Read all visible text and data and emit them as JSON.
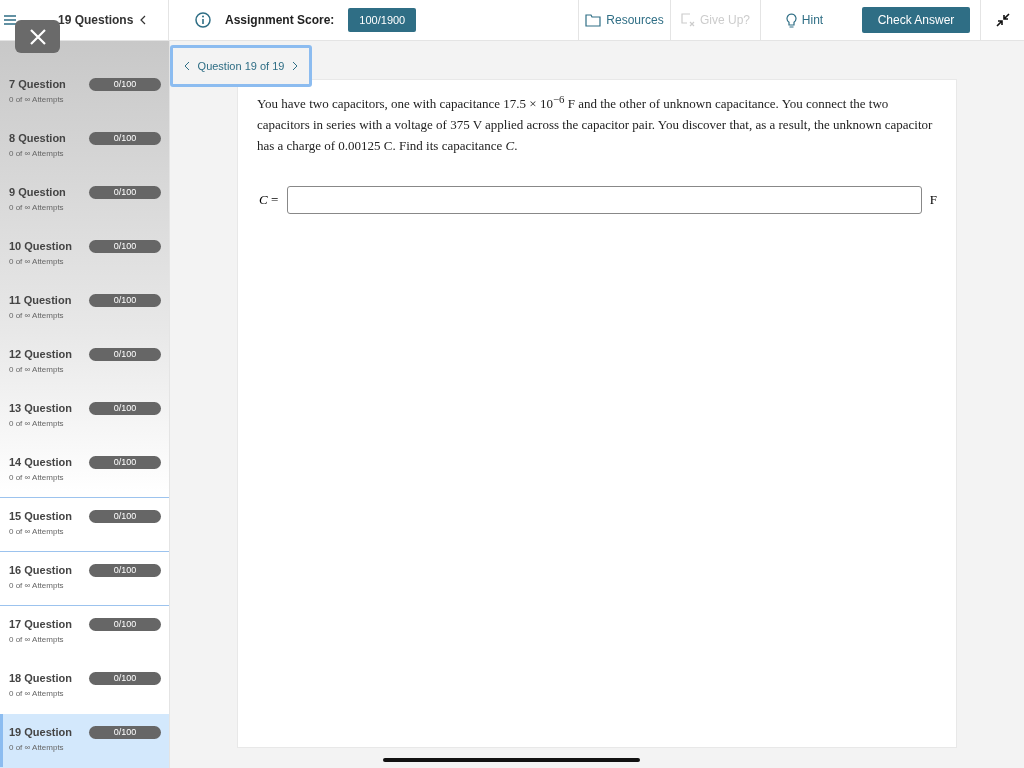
{
  "sidebar": {
    "header": "19 Questions",
    "items": [
      {
        "title": "7 Question",
        "score": "0/100",
        "attempts": "0 of ∞ Attempts",
        "selected": false,
        "outlined": false
      },
      {
        "title": "8 Question",
        "score": "0/100",
        "attempts": "0 of ∞ Attempts",
        "selected": false,
        "outlined": false
      },
      {
        "title": "9 Question",
        "score": "0/100",
        "attempts": "0 of ∞ Attempts",
        "selected": false,
        "outlined": false
      },
      {
        "title": "10 Question",
        "score": "0/100",
        "attempts": "0 of ∞ Attempts",
        "selected": false,
        "outlined": false
      },
      {
        "title": "11 Question",
        "score": "0/100",
        "attempts": "0 of ∞ Attempts",
        "selected": false,
        "outlined": false
      },
      {
        "title": "12 Question",
        "score": "0/100",
        "attempts": "0 of ∞ Attempts",
        "selected": false,
        "outlined": false
      },
      {
        "title": "13 Question",
        "score": "0/100",
        "attempts": "0 of ∞ Attempts",
        "selected": false,
        "outlined": false
      },
      {
        "title": "14 Question",
        "score": "0/100",
        "attempts": "0 of ∞ Attempts",
        "selected": false,
        "outlined": true
      },
      {
        "title": "15 Question",
        "score": "0/100",
        "attempts": "0 of ∞ Attempts",
        "selected": false,
        "outlined": true
      },
      {
        "title": "16 Question",
        "score": "0/100",
        "attempts": "0 of ∞ Attempts",
        "selected": false,
        "outlined": true
      },
      {
        "title": "17 Question",
        "score": "0/100",
        "attempts": "0 of ∞ Attempts",
        "selected": false,
        "outlined": false
      },
      {
        "title": "18 Question",
        "score": "0/100",
        "attempts": "0 of ∞ Attempts",
        "selected": false,
        "outlined": false
      },
      {
        "title": "19 Question",
        "score": "0/100",
        "attempts": "0 of ∞ Attempts",
        "selected": true,
        "outlined": false
      }
    ]
  },
  "toolbar": {
    "score_label": "Assignment Score:",
    "score": "100/1900",
    "resources": "Resources",
    "give_up": {
      "label": "Give Up?",
      "disabled": true
    },
    "hint": "Hint",
    "check": "Check Answer"
  },
  "question": {
    "nav": "Question 19 of 19",
    "text": "You have two capacitors, one with capacitance 17.5 × 10$^{−6}$ F and the other of unknown capacitance. You connect the two capacitors in series with a voltage of 375 V applied across the capacitor pair. You discover that, as a result, the unknown capacitor has a charge of 0.00125 C. Find its capacitance *C*.",
    "answer_label": "*C* =",
    "answer_unit": "F"
  }
}
